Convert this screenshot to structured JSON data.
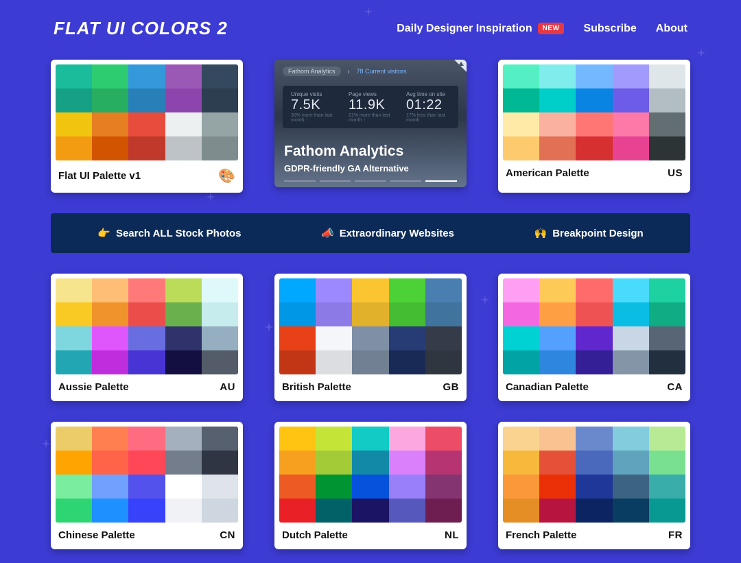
{
  "header": {
    "logo": "FLAT UI COLORS 2",
    "nav": {
      "inspiration": "Daily Designer Inspiration",
      "badge": "NEW",
      "subscribe": "Subscribe",
      "about": "About"
    }
  },
  "ad": {
    "pill": "Fathom Analytics",
    "link": "78 Current visitors",
    "metrics": [
      {
        "label": "Unique visits",
        "value": "7.5K",
        "sub": "30% more than last month ↑"
      },
      {
        "label": "Page views",
        "value": "11.9K",
        "sub": "21% more than last month ↑"
      },
      {
        "label": "Avg time on site",
        "value": "01:22",
        "sub": "17% less than last month"
      }
    ],
    "title": "Fathom Analytics",
    "subtitle": "GDPR-friendly GA Alternative"
  },
  "promo": {
    "stock": {
      "emoji": "👉",
      "text": "Search ALL Stock Photos"
    },
    "sites": {
      "emoji": "📣",
      "text": "Extraordinary Websites"
    },
    "breakpt": {
      "emoji": "🙌",
      "text": "Breakpoint Design"
    }
  },
  "palettes": [
    {
      "name": "Flat UI Palette v1",
      "badge_type": "emoji",
      "badge": "🎨",
      "colors": [
        "#1abc9c",
        "#2ecc71",
        "#3498db",
        "#9b59b6",
        "#34495e",
        "#16a085",
        "#27ae60",
        "#2980b9",
        "#8e44ad",
        "#2c3e50",
        "#f1c40f",
        "#e67e22",
        "#e74c3c",
        "#ecf0f1",
        "#95a5a6",
        "#f39c12",
        "#d35400",
        "#c0392b",
        "#bdc3c7",
        "#7f8c8d"
      ]
    },
    {
      "name": "American Palette",
      "badge_type": "code",
      "badge": "US",
      "colors": [
        "#55efc4",
        "#81ecec",
        "#74b9ff",
        "#a29bfe",
        "#dfe6e9",
        "#00b894",
        "#00cec9",
        "#0984e3",
        "#6c5ce7",
        "#b2bec3",
        "#ffeaa7",
        "#fab1a0",
        "#ff7675",
        "#fd79a8",
        "#636e72",
        "#fdcb6e",
        "#e17055",
        "#d63031",
        "#e84393",
        "#2d3436"
      ]
    },
    {
      "name": "Aussie Palette",
      "badge_type": "code",
      "badge": "AU",
      "colors": [
        "#f6e58d",
        "#ffbe76",
        "#ff7979",
        "#badc58",
        "#dff9fb",
        "#f9ca24",
        "#f0932b",
        "#eb4d4b",
        "#6ab04c",
        "#c7ecee",
        "#7ed6df",
        "#e056fd",
        "#686de0",
        "#30336b",
        "#95afc0",
        "#22a6b3",
        "#be2edd",
        "#4834d4",
        "#130f40",
        "#535c68"
      ]
    },
    {
      "name": "British Palette",
      "badge_type": "code",
      "badge": "GB",
      "colors": [
        "#00a8ff",
        "#9c88ff",
        "#fbc531",
        "#4cd137",
        "#487eb0",
        "#0097e6",
        "#8c7ae6",
        "#e1b12c",
        "#44bd32",
        "#40739e",
        "#e84118",
        "#f5f6fa",
        "#7f8fa6",
        "#273c75",
        "#353b48",
        "#c23616",
        "#dcdde1",
        "#718093",
        "#192a56",
        "#2f3640"
      ]
    },
    {
      "name": "Canadian Palette",
      "badge_type": "code",
      "badge": "CA",
      "colors": [
        "#ff9ff3",
        "#feca57",
        "#ff6b6b",
        "#48dbfb",
        "#1dd1a1",
        "#f368e0",
        "#ff9f43",
        "#ee5253",
        "#0abde3",
        "#10ac84",
        "#00d2d3",
        "#54a0ff",
        "#5f27cd",
        "#c8d6e5",
        "#576574",
        "#01a3a4",
        "#2e86de",
        "#341f97",
        "#8395a7",
        "#222f3e"
      ]
    },
    {
      "name": "Chinese Palette",
      "badge_type": "code",
      "badge": "CN",
      "colors": [
        "#eccc68",
        "#ff7f50",
        "#ff6b81",
        "#a4b0be",
        "#57606f",
        "#ffa502",
        "#ff6348",
        "#ff4757",
        "#747d8c",
        "#2f3542",
        "#7bed9f",
        "#70a1ff",
        "#5352ed",
        "#ffffff",
        "#dfe4ea",
        "#2ed573",
        "#1e90ff",
        "#3742fa",
        "#f1f2f6",
        "#ced6e0"
      ]
    },
    {
      "name": "Dutch Palette",
      "badge_type": "code",
      "badge": "NL",
      "colors": [
        "#ffc312",
        "#c4e538",
        "#12cbc4",
        "#fda7df",
        "#ed4c67",
        "#f79f1f",
        "#a3cb38",
        "#1289a7",
        "#d980fa",
        "#b53471",
        "#ee5a24",
        "#009432",
        "#0652dd",
        "#9980fa",
        "#833471",
        "#ea2027",
        "#006266",
        "#1b1464",
        "#5758bb",
        "#6f1e51"
      ]
    },
    {
      "name": "French Palette",
      "badge_type": "code",
      "badge": "FR",
      "colors": [
        "#fad390",
        "#f8c291",
        "#6a89cc",
        "#82ccdd",
        "#b8e994",
        "#f6b93b",
        "#e55039",
        "#4a69bd",
        "#60a3bc",
        "#78e08f",
        "#fa983a",
        "#eb2f06",
        "#1e3799",
        "#3c6382",
        "#38ada9",
        "#e58e26",
        "#b71540",
        "#0c2461",
        "#0a3d62",
        "#079992"
      ]
    }
  ]
}
